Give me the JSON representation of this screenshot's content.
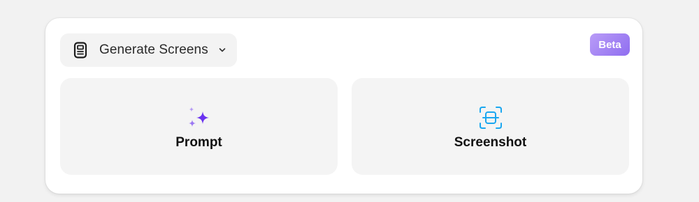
{
  "mode_select": {
    "label": "Generate Screens",
    "icon": "document-icon",
    "chevron": "chevron-down-icon"
  },
  "badge": {
    "label": "Beta",
    "color_start": "#b99cf7",
    "color_end": "#8f6ef0"
  },
  "cards": [
    {
      "label": "Prompt",
      "icon": "sparkles-icon",
      "icon_color": "#6a32f0"
    },
    {
      "label": "Screenshot",
      "icon": "screenshot-icon",
      "icon_color": "#1aa7f0"
    }
  ]
}
